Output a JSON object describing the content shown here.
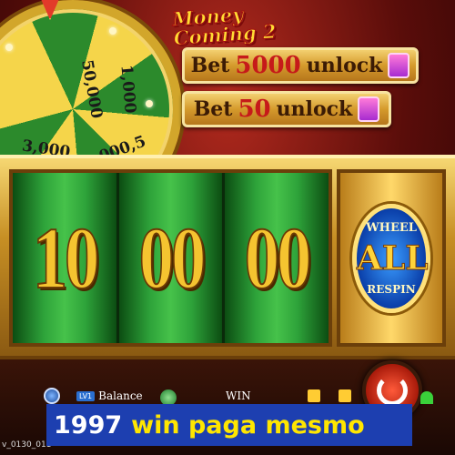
{
  "game": {
    "title": "Money Coming 2",
    "wheel_values": [
      "50,000",
      "1,000",
      "3,000",
      "000,5"
    ],
    "bets": [
      {
        "prefix": "Bet",
        "amount": "5000",
        "suffix": "unlock"
      },
      {
        "prefix": "Bet",
        "amount": "50",
        "suffix": "unlock"
      }
    ],
    "reels": [
      "10",
      "00",
      "00"
    ],
    "bonus_badge": {
      "top": "WHEEL",
      "middle": "ALL",
      "bottom": "RESPIN"
    }
  },
  "bottom_bar": {
    "level_chip": "LV1",
    "balance_label": "Balance",
    "win_label": "WIN",
    "version": "v_0130_011"
  },
  "caption": {
    "number": "1997",
    "text": "win paga mesmo"
  },
  "colors": {
    "caption_bg": "#1d3fb0",
    "caption_text": "#ffe600",
    "reel_green": "#2ea33a",
    "gold": "#d59a2c"
  }
}
